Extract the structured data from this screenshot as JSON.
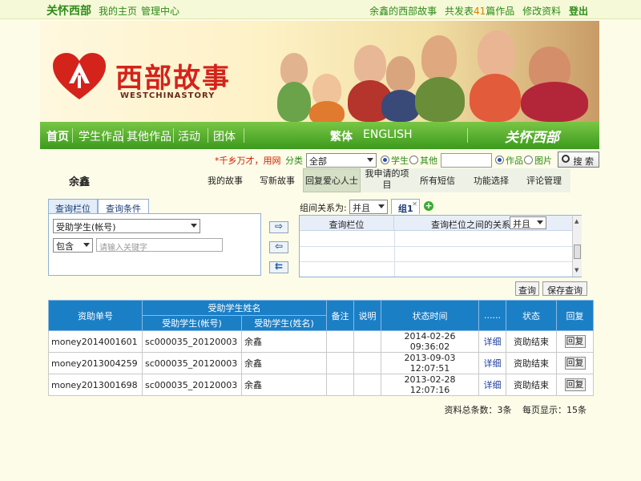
{
  "topbar": {
    "brand": "关怀西部",
    "nav_home": "我的主页",
    "nav_admin": "管理中心",
    "user_story": "余鑫的西部故事",
    "published_prefix": "共发表",
    "published_count": "41",
    "published_suffix": "篇作品",
    "edit_profile": "修改资料",
    "logout": "登出"
  },
  "banner": {
    "logo_text": "西部故事",
    "logo_sub": "WESTCHINASTORY"
  },
  "greennav": {
    "items": [
      "首页",
      "学生作品",
      "其他作品",
      "活动",
      "团体"
    ],
    "traditional": "繁体",
    "english": "ENGLISH",
    "signature": "关怀西部"
  },
  "search": {
    "slogan": "*千乡万才，用网",
    "category_label": "分类",
    "category_value": "全部",
    "radio_student": "学生",
    "radio_other": "其他",
    "radio_works": "作品",
    "radio_pictures": "图片",
    "search_button": "搜 索"
  },
  "userbar": {
    "name": "余鑫",
    "links": [
      "我的故事",
      "写新故事",
      "回复爱心人士",
      "我申请的项目",
      "所有短信",
      "功能选择",
      "评论管理"
    ]
  },
  "query": {
    "tab_fields": "查询栏位",
    "tab_conditions": "查询条件",
    "field_select": "受助学生(帐号)",
    "operator_select": "包含",
    "keyword_placeholder": "请输入关键字",
    "group_relation_label": "组间关系为:",
    "group_relation_value": "并且",
    "group_tab": "组1",
    "grid_col_field": "查询栏位",
    "grid_col_relation": "查询栏位之间的关系:",
    "grid_relation_value": "并且",
    "query_button": "查询",
    "save_button": "保存查询"
  },
  "table": {
    "headers": {
      "id": "资助单号",
      "student_group": "受助学生姓名",
      "student_account": "受助学生(帐号)",
      "student_name": "受助学生(姓名)",
      "note": "备注",
      "explain": "说明",
      "status_time": "状态时间",
      "dots": "......",
      "status": "状态",
      "reply": "回复"
    },
    "rows": [
      {
        "id": "money2014001601",
        "account": "sc000035_20120003",
        "name": "余鑫",
        "time": "2014-02-26 09:36:02",
        "detail": "详细",
        "status": "资助结束",
        "reply": "回复"
      },
      {
        "id": "money2013004259",
        "account": "sc000035_20120003",
        "name": "余鑫",
        "time": "2013-09-03 12:07:51",
        "detail": "详细",
        "status": "资助结束",
        "reply": "回复"
      },
      {
        "id": "money2013001698",
        "account": "sc000035_20120003",
        "name": "余鑫",
        "time": "2013-02-28 12:07:16",
        "detail": "详细",
        "status": "资助结束",
        "reply": "回复"
      }
    ]
  },
  "footer": {
    "total": "资料总条数：3条",
    "per_page": "每页显示：15条"
  },
  "colors": {
    "brand_green": "#2e8b1a",
    "nav_green": "#5cb132",
    "table_header": "#1b7fc6",
    "logo_red": "#d4231b"
  }
}
